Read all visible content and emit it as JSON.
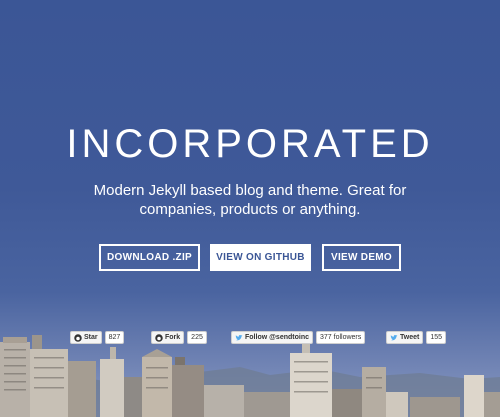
{
  "hero": {
    "title": "INCORPORATED",
    "tagline_line1": "Modern Jekyll based blog and theme. Great for",
    "tagline_line2": "companies, products or anything."
  },
  "buttons": {
    "download_label": "DOWNLOAD .ZIP",
    "github_label": "VIEW ON GITHUB",
    "demo_label": "VIEW DEMO"
  },
  "widgets": {
    "star_label": "Star",
    "star_count": "827",
    "fork_label": "Fork",
    "fork_count": "225",
    "follow_label": "Follow @sendtoinc",
    "follow_count": "377 followers",
    "tweet_label": "Tweet",
    "tweet_count": "155"
  },
  "colors": {
    "hero_blue": "#3b5696",
    "button_border": "#ffffff",
    "twitter_blue": "#55acee"
  },
  "icons": [
    "github-octocat-icon",
    "twitter-bird-icon"
  ]
}
